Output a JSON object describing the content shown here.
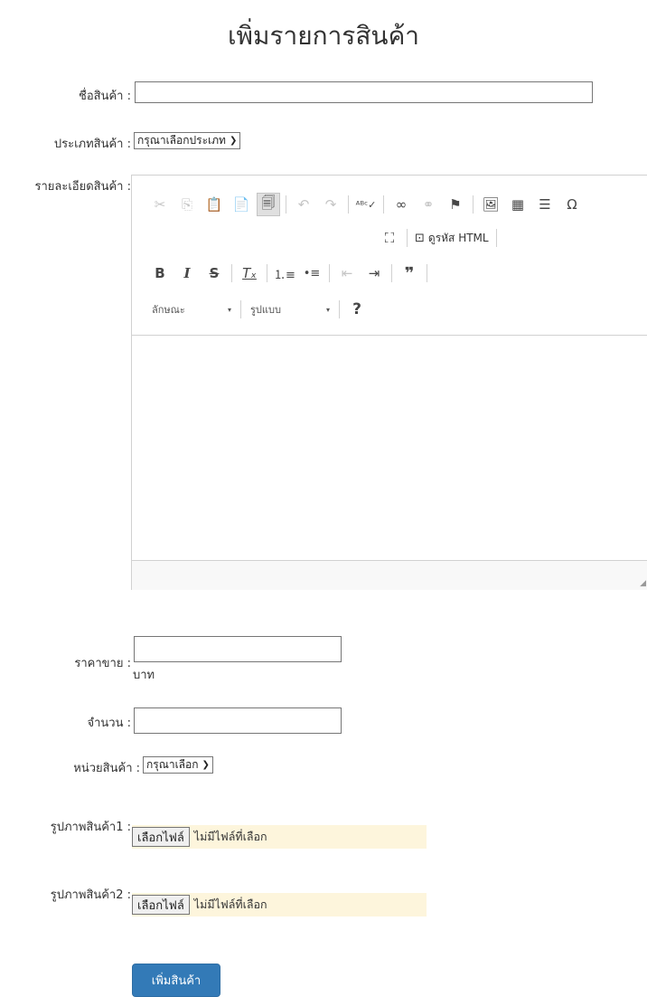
{
  "page_title": "เพิ่มรายการสินค้า",
  "fields": {
    "name_label": "ชื่อสินค้า :",
    "name_value": "",
    "type_label": "ประเภทสินค้า :",
    "type_selected": "กรุณาเลือกประเภท",
    "detail_label": "รายละเอียดสินค้า :",
    "price_label": "ราคาขาย :",
    "price_value": "",
    "price_unit": "บาท",
    "qty_label": "จำนวน :",
    "qty_value": "",
    "unit_label": "หน่วยสินค้า :",
    "unit_selected": "กรุณาเลือก",
    "image1_label": "รูปภาพสินค้า1 :",
    "image2_label": "รูปภาพสินค้า2 :",
    "file_button": "เลือกไฟล์",
    "file_status": "ไม่มีไฟล์ที่เลือก",
    "submit_label": "เพิ่มสินค้า"
  },
  "editor": {
    "toolbar_row1_icons": [
      "cut-icon",
      "copy-icon",
      "paste-icon",
      "paste-text-icon",
      "paste-word-icon",
      "undo-icon",
      "redo-icon",
      "spellcheck-icon",
      "link-icon",
      "unlink-icon",
      "anchor-icon",
      "image-icon",
      "table-icon",
      "horizontal-line-icon",
      "special-char-icon"
    ],
    "maximize_icon": "maximize-icon",
    "source_label": "ดูรหัส HTML",
    "toolbar_row3_icons": [
      "bold-icon",
      "italic-icon",
      "strike-icon",
      "remove-format-icon",
      "numbered-list-icon",
      "bulleted-list-icon",
      "outdent-icon",
      "indent-icon",
      "blockquote-icon"
    ],
    "styles_combo": "ลักษณะ",
    "format_combo": "รูปแบบ",
    "help_icon": "help-icon"
  }
}
